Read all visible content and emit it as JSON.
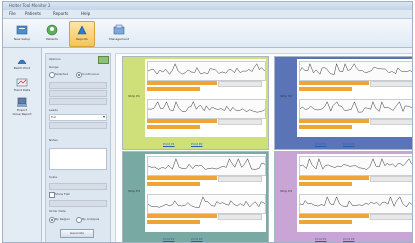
{
  "window": {
    "title": "Holter Tool Monitor 2"
  },
  "menu": [
    "File",
    "Patients",
    "Reports",
    "Help"
  ],
  "toolbar": [
    {
      "label": "New Setup",
      "icon": "new-setup-icon",
      "active": false
    },
    {
      "label": "Patients",
      "icon": "patients-icon",
      "active": false
    },
    {
      "label": "Reports",
      "icon": "reports-icon",
      "active": true
    },
    {
      "label": "Management",
      "icon": "management-icon",
      "active": false
    }
  ],
  "leftnav": [
    {
      "label": "Batch Print",
      "icon": "batch-print-icon"
    },
    {
      "label": "Trend Data",
      "icon": "trend-data-icon"
    },
    {
      "label": "Export",
      "icon": "export-icon"
    },
    {
      "label": "Close Report",
      "icon": "close-report-icon"
    }
  ],
  "settings": {
    "header": "Options",
    "range_label": "Range",
    "range_options": [
      "Selected",
      "Continuous"
    ],
    "range_selected": 1,
    "leads_label": "Leads",
    "leads_value": "Full",
    "notes_label": "Notes",
    "scale_label": "Scale",
    "show_flat_label": "Show Flat",
    "order_label": "Order Data",
    "order_options": [
      "By Region",
      "By Analysis"
    ],
    "button_label": "Generate"
  },
  "panels": [
    {
      "tag": "Strip P1",
      "color": "#cfe07a",
      "links": [
        "Print P1",
        "Print P2"
      ]
    },
    {
      "tag": "Strip P2",
      "color": "#5b74b8",
      "links": [
        "Print P1",
        "Print P2"
      ]
    },
    {
      "tag": "Strip P3",
      "color": "#79a9a3",
      "links": [
        "Print P1",
        "Print P2"
      ]
    },
    {
      "tag": "Strip P4",
      "color": "#c9a5d6",
      "links": [
        "Print P1",
        "Print P2"
      ]
    }
  ],
  "colors": {
    "accent": "#f1a436",
    "ribbon_active": "#f6c45a",
    "link": "#2b5fa5"
  }
}
